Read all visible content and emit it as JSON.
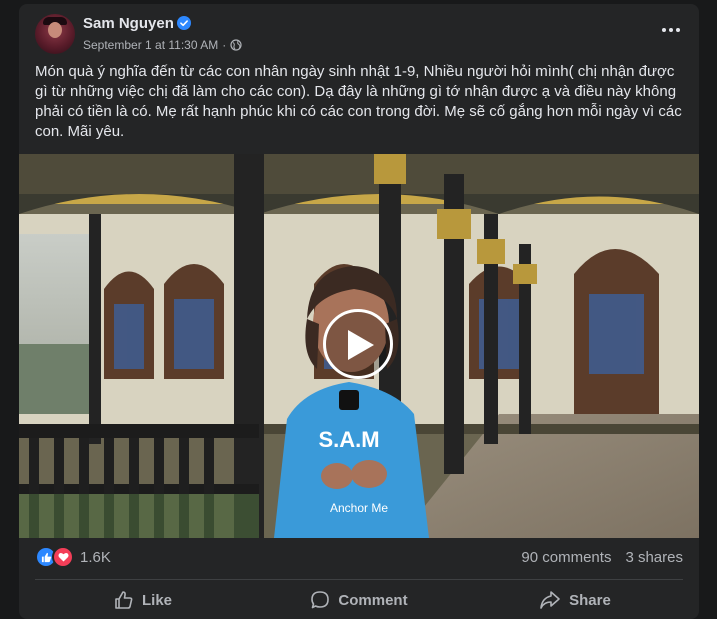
{
  "post": {
    "author": "Sam Nguyen",
    "timestamp": "September 1 at 11:30 AM",
    "audience_icon": "globe-icon",
    "caption": "Món quà ý nghĩa đến từ các con nhân ngày sinh nhật 1-9, Nhiều người hỏi mình( chị nhận được gì từ những việc chị đã làm cho các con). Dạ đây là những gì tớ nhận được ạ và điều này không phải có tiền là có. Mẹ rất hạnh phúc khi có các con trong đời. Mẹ sẽ cố gắng hơn mỗi ngày vì các con. Mãi yêu.",
    "video": {
      "shirt_text": "S.A.M",
      "shirt_subtext": "Anchor Me"
    }
  },
  "stats": {
    "reaction_count": "1.6K",
    "comments": "90 comments",
    "shares": "3 shares"
  },
  "actions": {
    "like": "Like",
    "comment": "Comment",
    "share": "Share"
  },
  "colors": {
    "card_bg": "#242526",
    "page_bg": "#18191a",
    "accent_blue": "#2d88ff",
    "love_red": "#f33e58",
    "text_primary": "#e4e6eb",
    "text_secondary": "#b0b3b8",
    "shirt_blue": "#3a9ad9"
  }
}
